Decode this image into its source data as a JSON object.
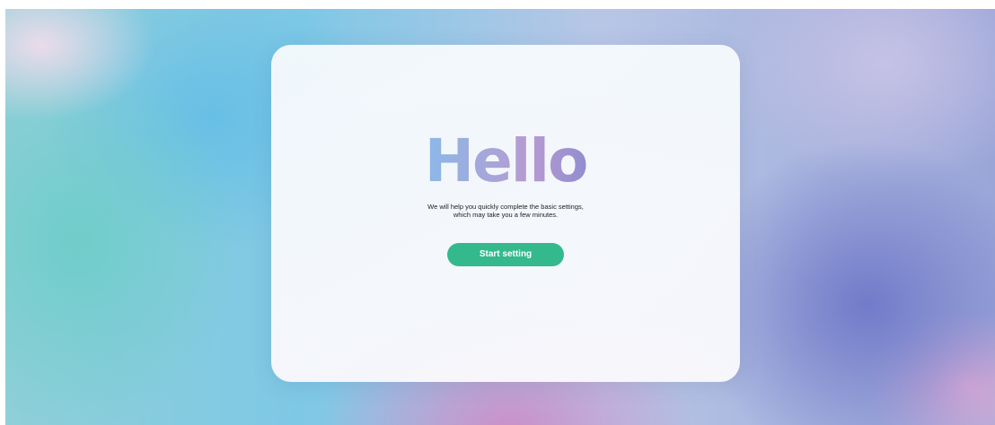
{
  "welcome": {
    "title": "Hello",
    "description_line1": "We will help you quickly complete the basic settings,",
    "description_line2": "which may take you a few minutes.",
    "start_button_label": "Start setting"
  },
  "colors": {
    "accent_button": "#34b98c",
    "title_gradient": [
      "#5ec9e0",
      "#b79ad0",
      "#6b6fbd"
    ]
  }
}
